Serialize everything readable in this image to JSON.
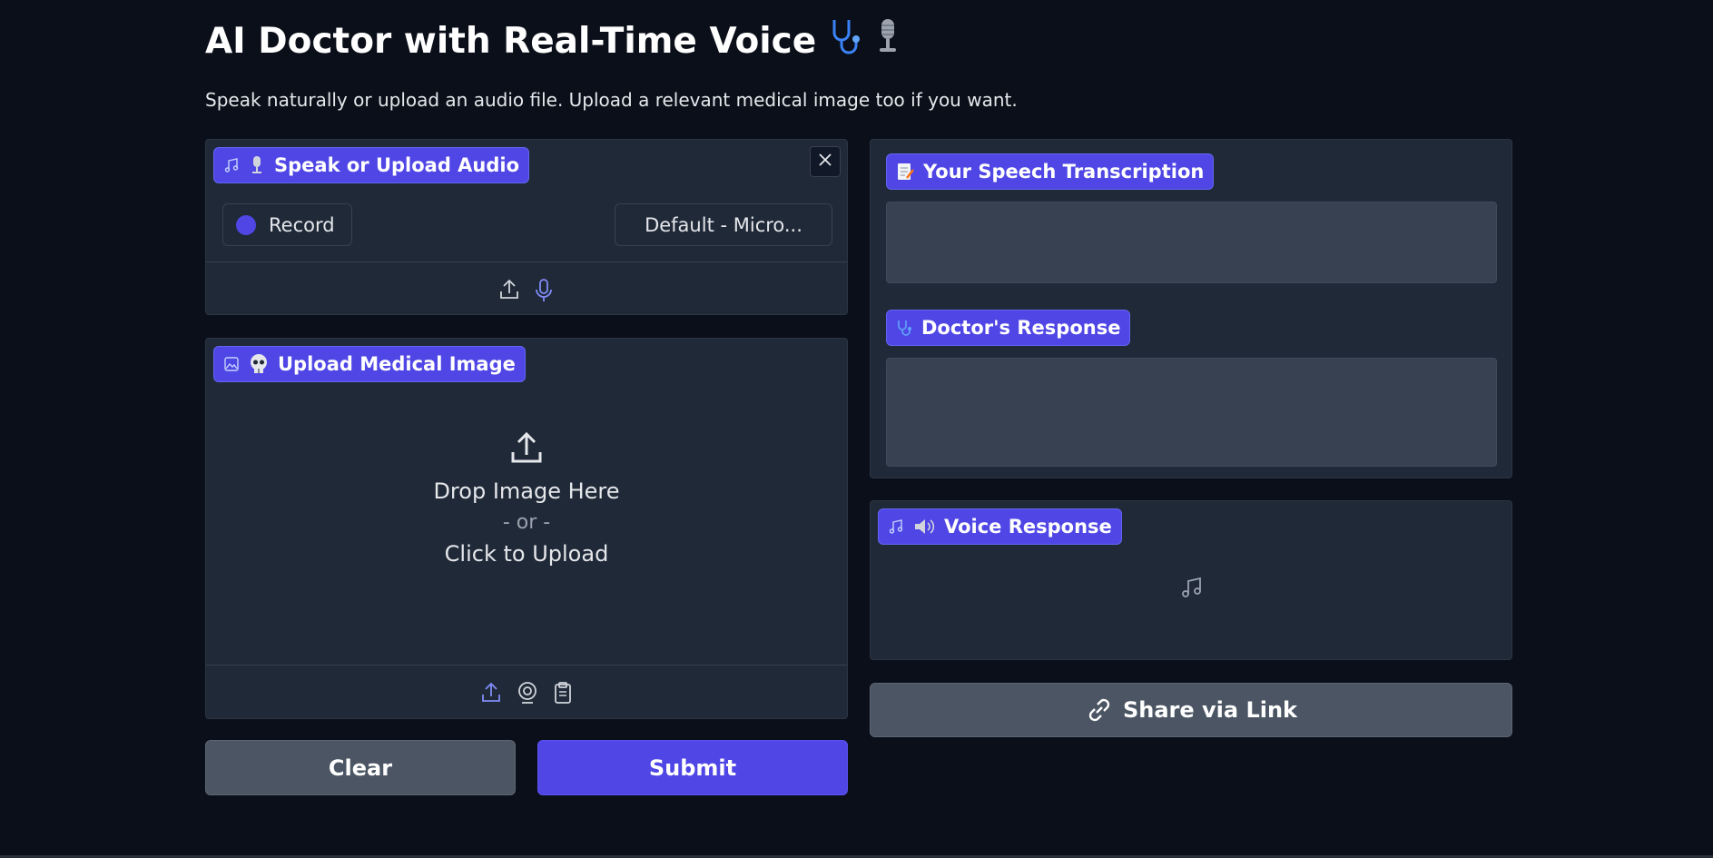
{
  "header": {
    "title": "AI Doctor with Real-Time Voice",
    "description": "Speak naturally or upload an audio file. Upload a relevant medical image too if you want."
  },
  "audio_input": {
    "label": "Speak or Upload Audio",
    "record_label": "Record",
    "microphone_selected": "Default - Micro..."
  },
  "image_input": {
    "label": "Upload Medical Image",
    "drop_text": "Drop Image Here",
    "or_text": "- or -",
    "click_text": "Click to Upload"
  },
  "transcription": {
    "label": "Your Speech Transcription",
    "value": ""
  },
  "doctor_response": {
    "label": "Doctor's Response",
    "value": ""
  },
  "voice_response": {
    "label": "Voice Response"
  },
  "actions": {
    "clear_label": "Clear",
    "submit_label": "Submit",
    "share_label": "Share via Link"
  },
  "colors": {
    "background": "#0b0f19",
    "panel": "#1f2937",
    "accent": "#4f46e5",
    "secondary_button": "#4b5563"
  },
  "icons": [
    "stethoscope-icon",
    "microphone-emoji-icon",
    "music-note-icon",
    "image-icon",
    "skull-emoji-icon",
    "memo-emoji-icon",
    "speaker-emoji-icon",
    "upload-icon",
    "mic-icon",
    "webcam-icon",
    "clipboard-icon",
    "link-icon",
    "close-icon"
  ]
}
